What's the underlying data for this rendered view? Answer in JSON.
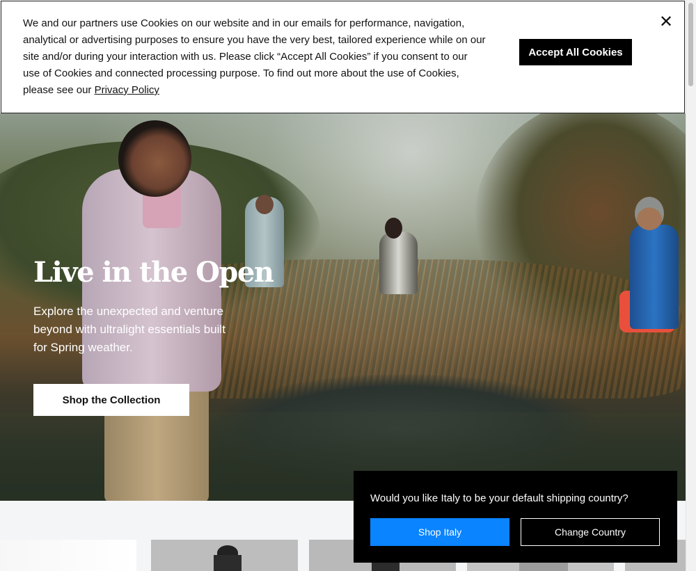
{
  "cookie_banner": {
    "text": "We and our partners use Cookies on our website and in our emails for performance, navigation, analytical or advertising purposes to ensure you have the very best, tailored experience while on our site and/or during your interaction with us. Please click “Accept All Cookies” if you consent to our use of Cookies and connected processing purpose. To find out more about the use of Cookies, please see our",
    "privacy_link": "Privacy Policy",
    "accept_label": "Accept All Cookies",
    "close_icon": "close-icon",
    "close_glyph": "✕"
  },
  "hero": {
    "title": "Live in the Open",
    "description": "Explore the unexpected and venture beyond with ultralight essentials built for Spring weather.",
    "cta_label": "Shop the Collection"
  },
  "shipping_popup": {
    "question": "Would you like Italy to be your default shipping country?",
    "shop_label": "Shop Italy",
    "change_label": "Change Country",
    "primary_color": "#0a84ff"
  }
}
